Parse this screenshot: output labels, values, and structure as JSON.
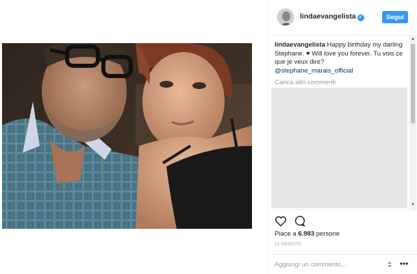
{
  "post": {
    "username": "lindaevangelista",
    "follow_label": "Segui",
    "caption_user": "lindaevangelista",
    "caption_text": " Happy birthday my darling Stephane. ♥ Will love you forever. Tu vois ce que je veux dire?",
    "caption_mention": "@stephane_marais_official",
    "load_more_label": "Carica altri commenti",
    "likes_prefix": "Piace a ",
    "likes_count": "6.983",
    "likes_suffix": " persone",
    "date": "11 AGOSTO",
    "comment_placeholder": "Aggiungi un commento...",
    "more_symbol": "•••"
  },
  "colors": {
    "accent": "#3897f0",
    "text": "#262626",
    "muted": "#999999",
    "mention": "#003569"
  },
  "icons": {
    "verified": "verified-badge-icon",
    "like": "heart-icon",
    "comment": "comment-bubble-icon",
    "more": "more-options-icon"
  }
}
